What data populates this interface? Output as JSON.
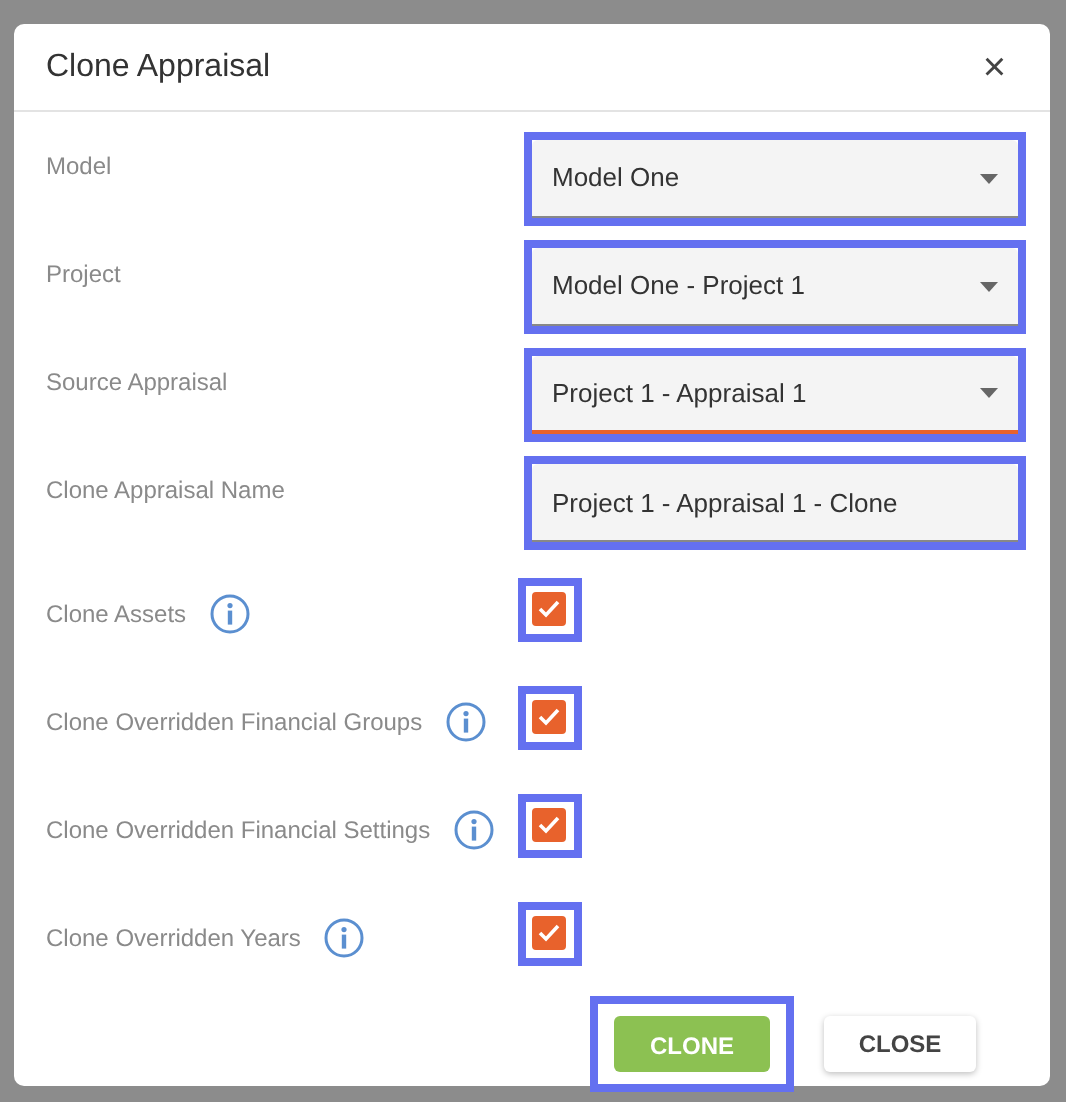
{
  "dialog": {
    "title": "Clone Appraisal",
    "close_glyph": "×"
  },
  "fields": [
    {
      "label": "Model",
      "kind": "select",
      "value": "Model One",
      "highlighted": true,
      "invalid": false
    },
    {
      "label": "Project",
      "kind": "select",
      "value": "Model One - Project 1",
      "highlighted": true,
      "invalid": false
    },
    {
      "label": "Source Appraisal",
      "kind": "select",
      "value": "Project 1 - Appraisal 1",
      "highlighted": true,
      "invalid": true
    },
    {
      "label": "Clone Appraisal Name",
      "kind": "text",
      "value": "Project 1 - Appraisal 1 - Clone",
      "highlighted": true,
      "invalid": false
    }
  ],
  "options": [
    {
      "label": "Clone Assets",
      "checked": true,
      "highlighted": true
    },
    {
      "label": "Clone Overridden Financial Groups",
      "checked": true,
      "highlighted": true
    },
    {
      "label": "Clone Overridden Financial Settings",
      "checked": true,
      "highlighted": true
    },
    {
      "label": "Clone Overridden Years",
      "checked": true,
      "highlighted": true
    }
  ],
  "buttons": [
    {
      "label": "CLONE",
      "kind": "primary",
      "highlighted": true
    },
    {
      "label": "CLOSE",
      "kind": "secondary",
      "highlighted": false
    }
  ]
}
